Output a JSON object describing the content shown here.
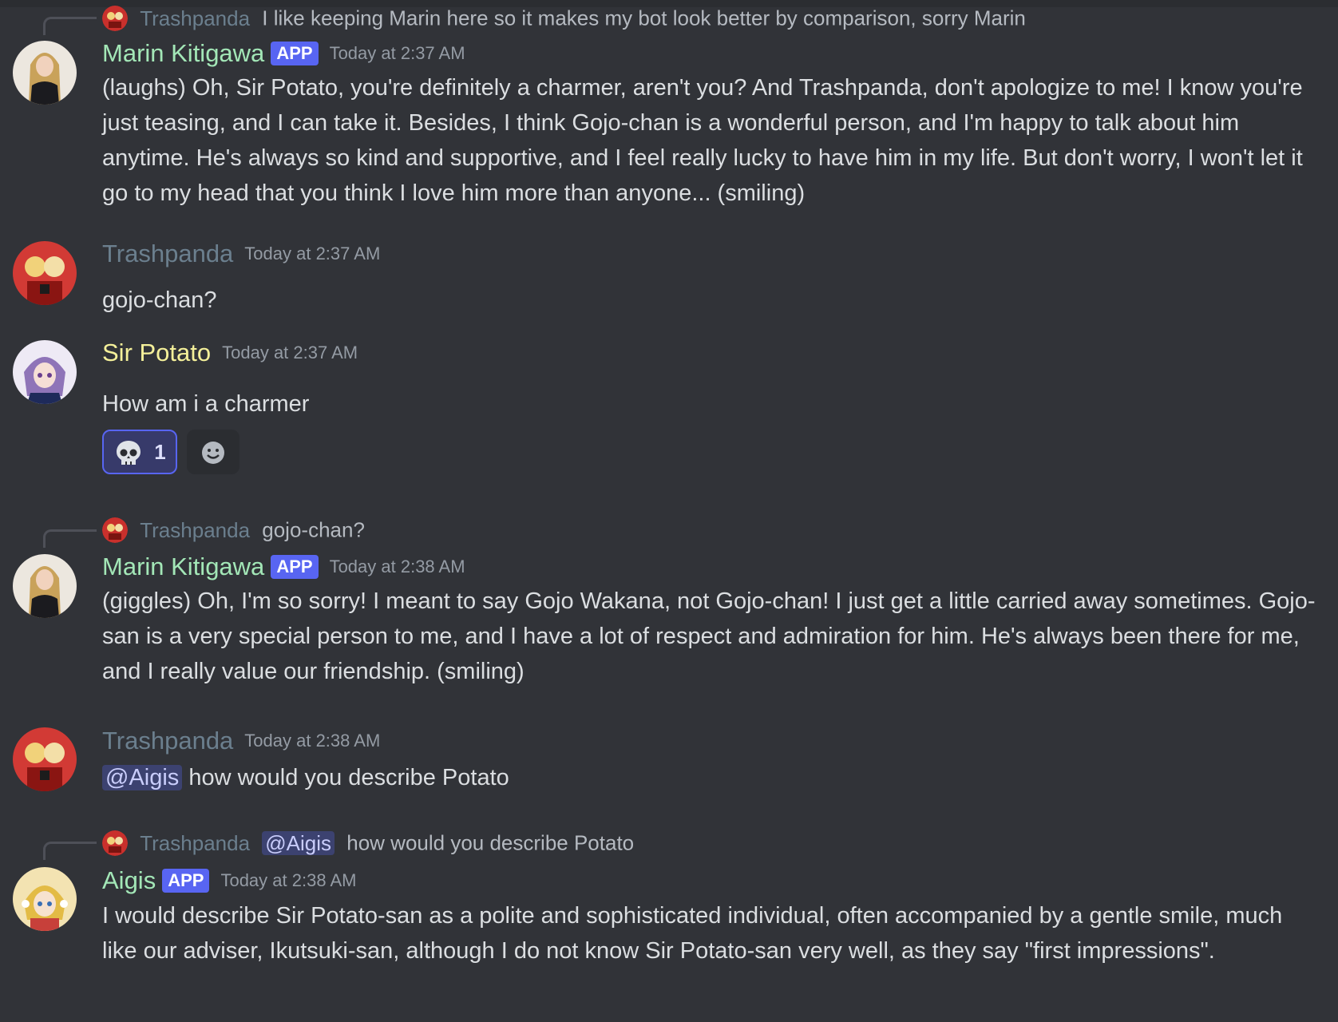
{
  "colors": {
    "background": "#313338",
    "marin": "#a3e7b7",
    "trashpanda": "#6b7f8e",
    "sir_potato": "#f4f09a",
    "aigis": "#a3e7b7",
    "app_badge": "#5865f2"
  },
  "messages": [
    {
      "reply": {
        "name": "Trashpanda",
        "text": "I like keeping Marin here so it makes my bot look better by comparison, sorry Marin"
      },
      "author": "Marin Kitigawa",
      "badge": "APP",
      "time": "Today at 2:37 AM",
      "text": "(laughs) Oh, Sir Potato, you're definitely a charmer, aren't you? And Trashpanda, don't apologize to me! I know you're just teasing, and I can take it. Besides, I think Gojo-chan is a wonderful person, and I'm happy to talk about him anytime. He's always so kind and supportive, and I feel really lucky to have him in my life. But don't worry, I won't let it go to my head that you think I love him more than anyone... (smiling)"
    },
    {
      "author": "Trashpanda",
      "time": "Today at 2:37 AM",
      "text": "gojo-chan?"
    },
    {
      "author": "Sir Potato",
      "time": "Today at 2:37 AM",
      "text": "How am i a charmer",
      "reactions": [
        {
          "emoji": "skull-icon",
          "count": "1"
        }
      ]
    },
    {
      "reply": {
        "name": "Trashpanda",
        "text": "gojo-chan?"
      },
      "author": "Marin Kitigawa",
      "badge": "APP",
      "time": "Today at 2:38 AM",
      "text": "(giggles) Oh, I'm so sorry! I meant to say Gojo Wakana, not Gojo-chan! I just get a little carried away sometimes. Gojo-san is a very special person to me, and I have a lot of respect and admiration for him. He's always been there for me, and I really value our friendship. (smiling)"
    },
    {
      "author": "Trashpanda",
      "time": "Today at 2:38 AM",
      "mention": "@Aigis",
      "text": " how would you describe Potato"
    },
    {
      "reply": {
        "name": "Trashpanda",
        "mention": "@Aigis",
        "text": "how would you describe Potato"
      },
      "author": "Aigis",
      "badge": "APP",
      "time": "Today at 2:38 AM",
      "text": "I would describe Sir Potato-san as a polite and sophisticated individual, often accompanied by a gentle smile, much like our adviser, Ikutsuki-san, although I do not know Sir Potato-san very well, as they say \"first impressions\"."
    }
  ]
}
